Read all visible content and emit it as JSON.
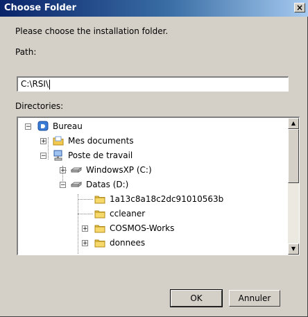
{
  "window": {
    "title": "Choose Folder",
    "close_glyph": "×"
  },
  "dialog": {
    "prompt": "Please choose the installation folder.",
    "path_label": "Path:",
    "path_value": "C:\\RSI\\",
    "directories_label": "Directories:"
  },
  "tree": {
    "items": [
      {
        "label": "Bureau",
        "icon": "desktop-icon",
        "expander": "−"
      },
      {
        "label": "Mes documents",
        "icon": "folder-icon",
        "expander": "+"
      },
      {
        "label": "Poste de travail",
        "icon": "computer-icon",
        "expander": "−"
      },
      {
        "label": "WindowsXP (C:)",
        "icon": "drive-icon",
        "expander": "+"
      },
      {
        "label": "Datas (D:)",
        "icon": "drive-icon",
        "expander": "−"
      },
      {
        "label": "1a13c8a18c2dc91010563b",
        "icon": "folder-icon",
        "expander": ""
      },
      {
        "label": "ccleaner",
        "icon": "folder-icon",
        "expander": ""
      },
      {
        "label": "COSMOS-Works",
        "icon": "folder-icon",
        "expander": "+"
      },
      {
        "label": "donnees",
        "icon": "folder-icon",
        "expander": "+"
      }
    ]
  },
  "scrollbar": {
    "up_glyph": "▲",
    "down_glyph": "▼"
  },
  "buttons": {
    "ok": "OK",
    "cancel": "Annuler"
  }
}
